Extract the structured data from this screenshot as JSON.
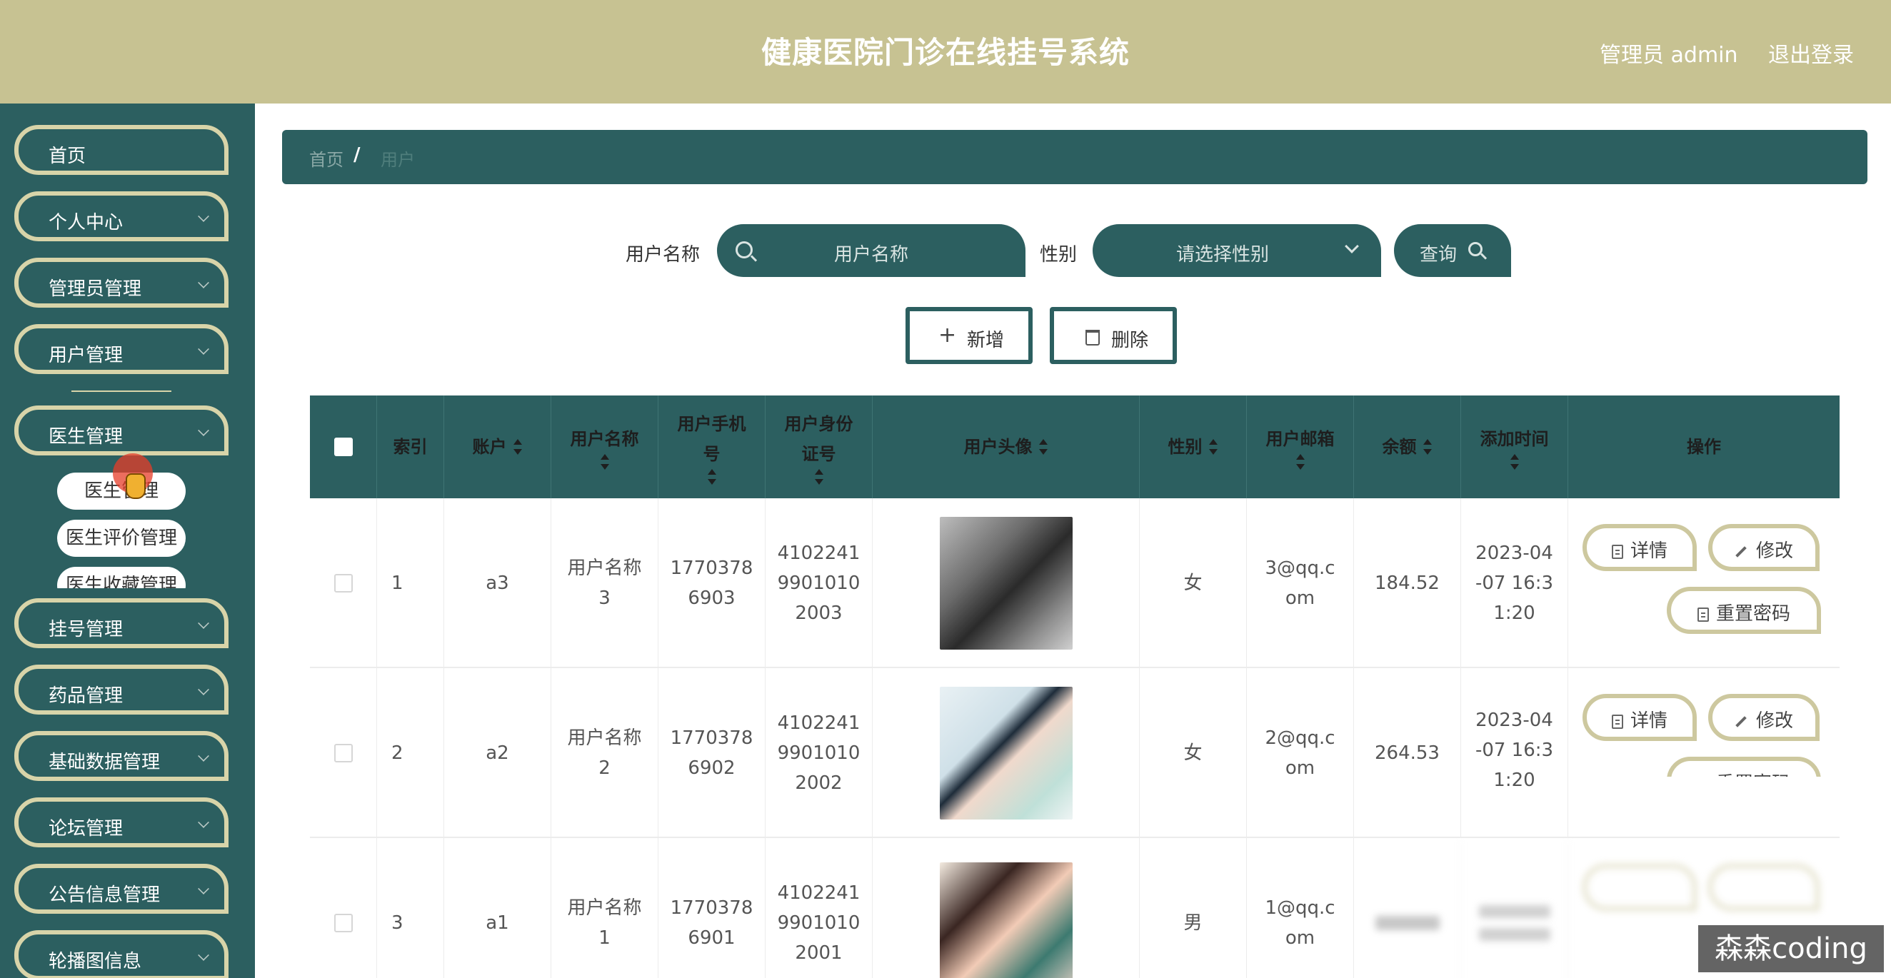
{
  "header": {
    "title": "健康医院门诊在线挂号系统",
    "admin": "管理员 admin",
    "logout": "退出登录"
  },
  "sidebar": {
    "items": [
      {
        "label": "首页"
      },
      {
        "label": "个人中心"
      },
      {
        "label": "管理员管理"
      },
      {
        "label": "用户管理"
      },
      {
        "label": "医生管理"
      },
      {
        "label": "挂号管理"
      },
      {
        "label": "药品管理"
      },
      {
        "label": "基础数据管理"
      },
      {
        "label": "论坛管理"
      },
      {
        "label": "公告信息管理"
      },
      {
        "label": "轮播图信息"
      }
    ],
    "sub_items": [
      "医生管理",
      "医生评价管理",
      "医生收藏管理"
    ]
  },
  "breadcrumb": {
    "home": "首页",
    "separator": "/",
    "current": "用户"
  },
  "search": {
    "name_label": "用户名称",
    "name_placeholder": "用户名称",
    "gender_label": "性别",
    "gender_placeholder": "请选择性别",
    "query_label": "查询"
  },
  "actions": {
    "add": "新增",
    "delete": "删除"
  },
  "table": {
    "headers": [
      "索引",
      "账户",
      "用户名称",
      "用户手机号",
      "用户身份证号",
      "用户头像",
      "性别",
      "用户邮箱",
      "余额",
      "添加时间",
      "操作"
    ],
    "rows": [
      {
        "index": "1",
        "account": "a3",
        "name": "用户名称3",
        "phone": "17703786903",
        "id_card": "410224199010102003",
        "gender": "女",
        "email": "3@qq.com",
        "balance": "184.52",
        "time": "2023-04-07 16:31:20"
      },
      {
        "index": "2",
        "account": "a2",
        "name": "用户名称2",
        "phone": "17703786902",
        "id_card": "410224199010102002",
        "gender": "女",
        "email": "2@qq.com",
        "balance": "264.53",
        "time": "2023-04-07 16:31:20"
      },
      {
        "index": "3",
        "account": "a1",
        "name": "用户名称1",
        "phone": "17703786901",
        "id_card": "410224199010102001",
        "gender": "男",
        "email": "1@qq.com",
        "balance": "",
        "time": ""
      }
    ],
    "op_labels": {
      "detail": "详情",
      "edit": "修改",
      "reset": "重置密码"
    }
  },
  "watermark": "森森coding",
  "colors": {
    "header": "#c7c292",
    "primary": "#2c5f60",
    "accent_border": "#d8d4a9"
  }
}
